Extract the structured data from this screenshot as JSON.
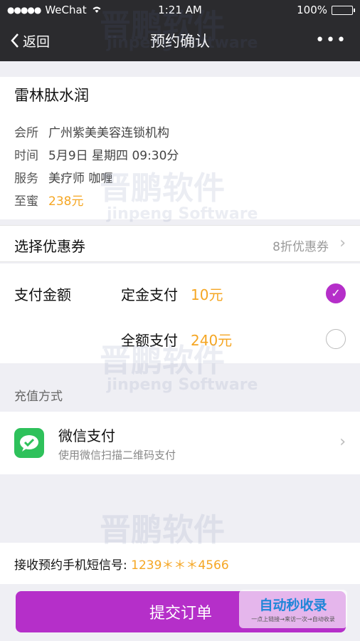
{
  "statusbar": {
    "carrier": "WeChat",
    "time": "1:21 AM",
    "battery": "100%"
  },
  "nav": {
    "back_label": "返回",
    "title": "预约确认",
    "more": "•••"
  },
  "info": {
    "name": "雷林肽水润",
    "rows": [
      {
        "label": "会所",
        "value": "广州紫美美容连锁机构"
      },
      {
        "label": "时间",
        "value": "5月9日  星期四  09:30分"
      },
      {
        "label": "服务",
        "value": "美疗师 咖喱"
      },
      {
        "label": "至蜜",
        "value": "238元"
      }
    ]
  },
  "coupon": {
    "label": "选择优惠券",
    "value": "8折优惠券"
  },
  "payment": {
    "label": "支付金额",
    "options": [
      {
        "label": "定金支付",
        "amount": "10元",
        "selected": true
      },
      {
        "label": "全额支付",
        "amount": "240元",
        "selected": false
      }
    ]
  },
  "method": {
    "header": "充值方式",
    "title": "微信支付",
    "subtitle": "使用微信扫描二维码支付"
  },
  "phone": {
    "label": "接收预约手机短信号:",
    "value": "1239＊＊＊4566"
  },
  "submit": {
    "label": "提交订单"
  },
  "watermark": {
    "title": "晋鹏软件",
    "subtitle": "jinpeng Software"
  },
  "logo": {
    "main": "自动秒收录",
    "sub": "一点上链接→来访一次→自动收录"
  },
  "colors": {
    "accent": "#b52fc9",
    "price": "#f5a623",
    "wechat": "#2ec15b",
    "bar": "#2b2b2e"
  }
}
